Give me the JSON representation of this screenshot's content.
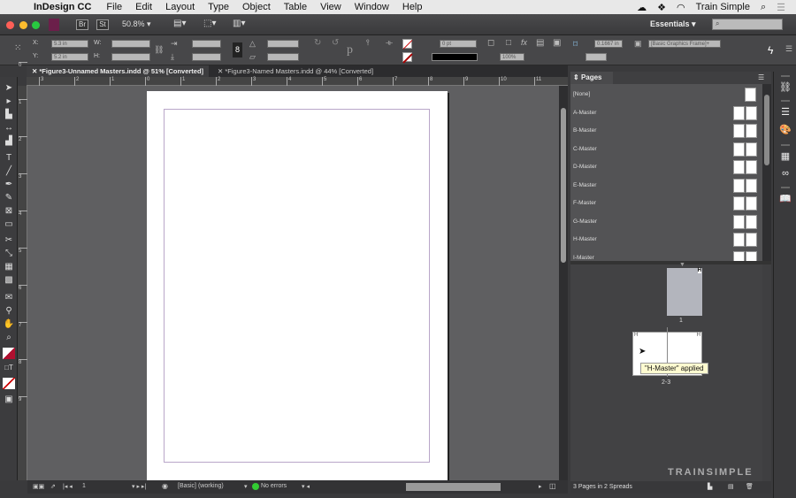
{
  "menubar": {
    "app": "InDesign CC",
    "items": [
      "File",
      "Edit",
      "Layout",
      "Type",
      "Object",
      "Table",
      "View",
      "Window",
      "Help"
    ],
    "user": "Train Simple"
  },
  "appbar": {
    "bridge": "Br",
    "stock": "St",
    "zoom": "50.8%",
    "workspace": "Essentials",
    "search_placeholder": ""
  },
  "control": {
    "x_label": "X:",
    "x_value": "5.3 in",
    "y_label": "Y:",
    "y_value": "5.2 in",
    "w_label": "W:",
    "w_value": "",
    "h_label": "H:",
    "h_value": "",
    "stroke_weight": "0 pt",
    "opacity": "100%",
    "offset": "0.1667 in",
    "object_style": "[Basic Graphics Frame]+"
  },
  "tabs": [
    {
      "label": "*Figure3-Unnamed Masters.indd @ 51% [Converted]",
      "active": true
    },
    {
      "label": "*Figure3-Named Masters.indd @ 44% [Converted]",
      "active": false
    }
  ],
  "hruler": [
    "3",
    "2",
    "1",
    "0",
    "1",
    "2",
    "3",
    "4",
    "5",
    "6",
    "7",
    "8",
    "9",
    "10",
    "11"
  ],
  "vruler": [
    "0",
    "1",
    "2",
    "3",
    "4",
    "5",
    "6",
    "7",
    "8",
    "9"
  ],
  "status": {
    "page": "1",
    "preflight_profile": "[Basic] (working)",
    "errors": "No errors"
  },
  "pages_panel": {
    "title": "Pages",
    "masters": [
      {
        "label": "[None]",
        "single": true
      },
      {
        "label": "A-Master"
      },
      {
        "label": "B-Master"
      },
      {
        "label": "C-Master"
      },
      {
        "label": "D-Master"
      },
      {
        "label": "E-Master"
      },
      {
        "label": "F-Master"
      },
      {
        "label": "G-Master"
      },
      {
        "label": "H-Master"
      },
      {
        "label": "I-Master"
      }
    ],
    "page1": {
      "label": "1",
      "master": "H"
    },
    "spread": {
      "label": "2-3",
      "left_master": "H",
      "right_master": "H"
    },
    "tooltip": "\"H-Master\" applied",
    "footer": "3 Pages in 2 Spreads"
  },
  "brand": "TRAINSIMPLE",
  "colors": {
    "accent": "#ff5f57",
    "page_thumb_selected": "#b3b5bd",
    "margin_guide": "#b9a6c9"
  }
}
